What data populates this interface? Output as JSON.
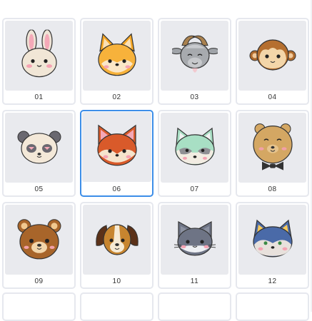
{
  "grid": {
    "items": [
      {
        "label": "01",
        "icon": "bunny-face-icon"
      },
      {
        "label": "02",
        "icon": "fox-shiba-face-icon"
      },
      {
        "label": "03",
        "icon": "goat-face-icon"
      },
      {
        "label": "04",
        "icon": "monkey-face-icon"
      },
      {
        "label": "05",
        "icon": "panda-face-icon"
      },
      {
        "label": "06",
        "icon": "fox-face-icon",
        "selected": true
      },
      {
        "label": "07",
        "icon": "raccoon-face-icon"
      },
      {
        "label": "08",
        "icon": "bear-bowtie-face-icon"
      },
      {
        "label": "09",
        "icon": "brown-bear-face-icon"
      },
      {
        "label": "10",
        "icon": "puppy-face-icon"
      },
      {
        "label": "11",
        "icon": "gray-cat-face-icon"
      },
      {
        "label": "12",
        "icon": "blue-wolf-face-icon"
      }
    ]
  },
  "colors": {
    "selection": "#3d8ee8",
    "thumb_bg": "#e9eaee",
    "card_border": "#e6e8ee"
  }
}
